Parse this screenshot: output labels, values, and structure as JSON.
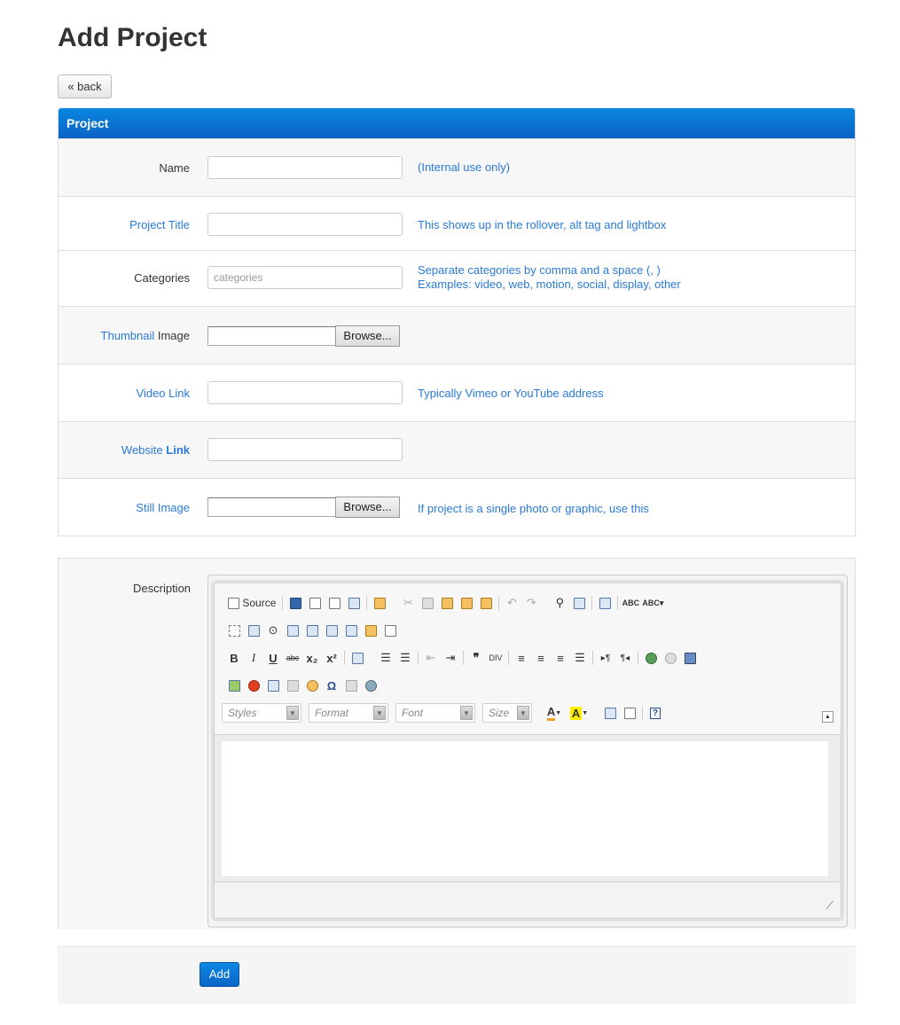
{
  "page": {
    "title": "Add Project"
  },
  "actions": {
    "back_label": "« back",
    "add_label": "Add"
  },
  "panel": {
    "title": "Project"
  },
  "fields": {
    "name": {
      "label": "Name",
      "value": "",
      "help": "(Internal use only)"
    },
    "project_title": {
      "label": "Project Title",
      "value": "",
      "help": "This shows up in the rollover, alt tag and lightbox"
    },
    "categories": {
      "label": "Categories",
      "value": "",
      "placeholder": "categories",
      "help_line1": "Separate categories by comma and a space (, )",
      "help_line2": "Examples: video, web, motion, social, display, other"
    },
    "thumbnail": {
      "label_part1": "Thumbnail",
      "label_part2": " Image",
      "browse_label": "Browse..."
    },
    "video_link": {
      "label": "Video Link",
      "value": "",
      "help": "Typically Vimeo or YouTube address"
    },
    "website_link": {
      "label_part1": "Website",
      "label_part2": " Link",
      "value": ""
    },
    "still_image": {
      "label": "Still Image",
      "browse_label": "Browse...",
      "help": "If project is a single photo or graphic, use this"
    },
    "description": {
      "label": "Description"
    }
  },
  "editor": {
    "source_label": "Source",
    "combos": {
      "styles": "Styles",
      "format": "Format",
      "font": "Font",
      "size": "Size"
    },
    "icons": {
      "row1": [
        "source-icon",
        "save-icon",
        "new-page-icon",
        "preview-icon",
        "print-icon",
        "templates-icon",
        "cut-icon",
        "copy-icon",
        "paste-icon",
        "paste-text-icon",
        "paste-word-icon",
        "undo-icon",
        "redo-icon",
        "find-icon",
        "replace-icon",
        "select-all-icon",
        "spellcheck-icon",
        "scayt-icon"
      ],
      "row2": [
        "form-icon",
        "checkbox-icon",
        "radio-icon",
        "textfield-icon",
        "textarea-icon",
        "select-icon",
        "button-icon",
        "image-button-icon",
        "hidden-field-icon"
      ],
      "row3": [
        "bold-icon",
        "italic-icon",
        "underline-icon",
        "strike-icon",
        "subscript-icon",
        "superscript-icon",
        "remove-format-icon",
        "numbered-list-icon",
        "bulleted-list-icon",
        "outdent-icon",
        "indent-icon",
        "blockquote-icon",
        "div-icon",
        "align-left-icon",
        "align-center-icon",
        "align-right-icon",
        "justify-icon",
        "ltr-icon",
        "rtl-icon",
        "link-icon",
        "unlink-icon",
        "anchor-icon"
      ],
      "row4": [
        "image-icon",
        "flash-icon",
        "table-icon",
        "horizontal-rule-icon",
        "smiley-icon",
        "special-char-icon",
        "page-break-icon",
        "iframe-icon"
      ],
      "row5": [
        "text-color-icon",
        "bg-color-icon",
        "maximize-icon",
        "show-blocks-icon",
        "about-icon"
      ]
    },
    "content": ""
  }
}
